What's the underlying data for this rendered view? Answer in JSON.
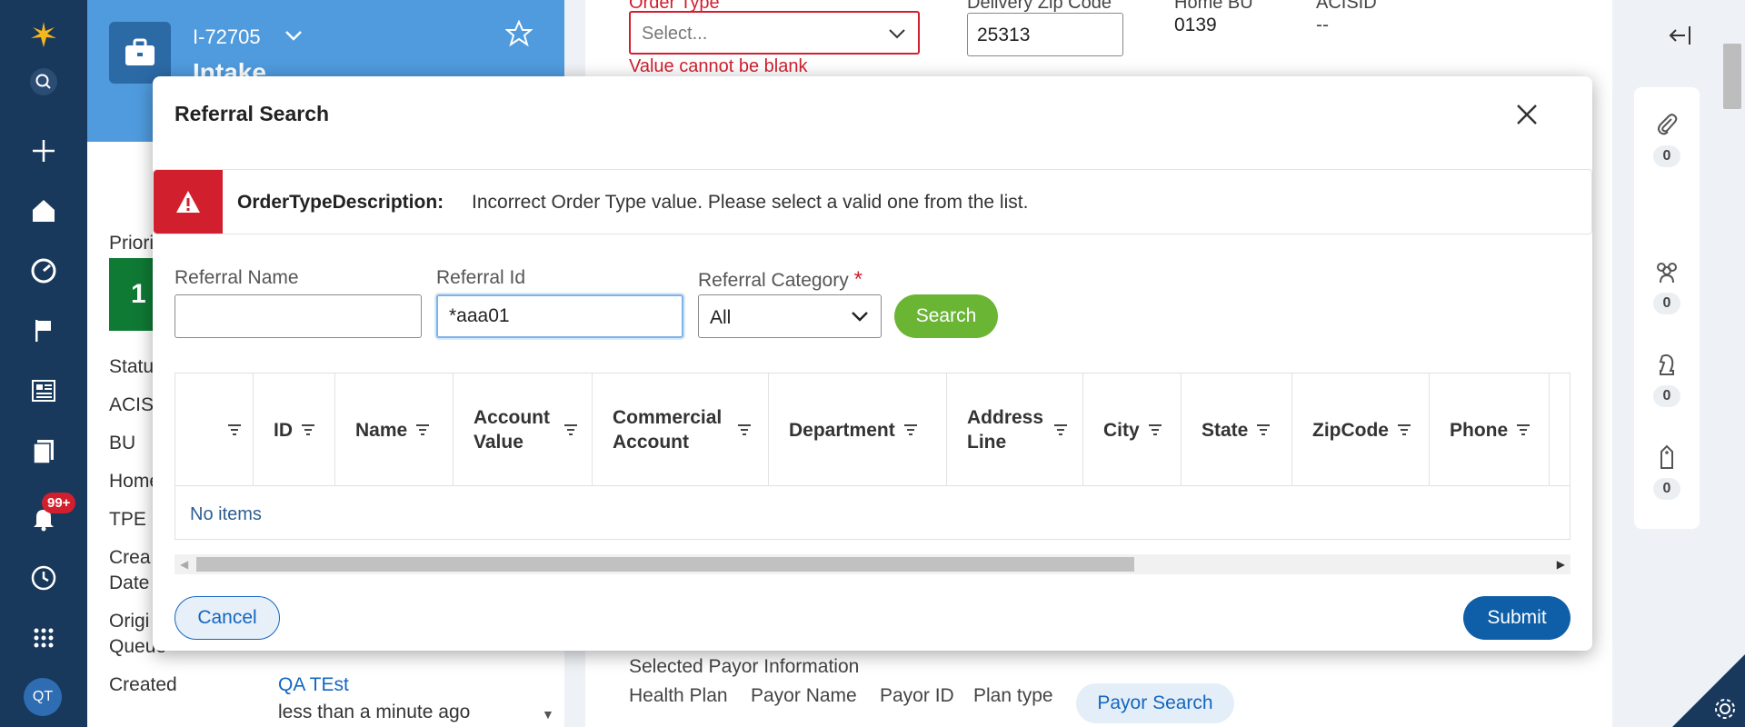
{
  "case": {
    "id": "I-72705",
    "title": "Intake",
    "priority_value": "1",
    "field_labels": [
      "Priority",
      "Status",
      "ACIS",
      "BU",
      "Home",
      "TPE",
      "Crea",
      "Date",
      "Origi",
      "Queue",
      "Created"
    ],
    "created_by": "QA TEst",
    "created_when": "less than a minute ago"
  },
  "nav": {
    "badge": "99+",
    "avatar": "QT"
  },
  "form": {
    "order_type_label": "Order Type",
    "order_type_placeholder": "Select...",
    "order_type_error": "Value cannot be blank",
    "delivery_zip_label": "Delivery Zip Code",
    "delivery_zip_value": "25313",
    "home_bu_label": "Home BU",
    "home_bu_value": "0139",
    "acisid_label": "ACISID",
    "acisid_value": "--",
    "payor_section_title": "Selected Payor Information",
    "payor_columns": [
      "Health Plan",
      "Payor Name",
      "Payor ID",
      "Plan type"
    ],
    "payor_search_label": "Payor Search"
  },
  "rail": {
    "counts": [
      "0",
      "0",
      "0",
      "0"
    ]
  },
  "modal": {
    "title": "Referral Search",
    "alert_key": "OrderTypeDescription:",
    "alert_message": "Incorrect Order Type value. Please select a valid one from the list.",
    "referral_name_label": "Referral Name",
    "referral_name_value": "",
    "referral_id_label": "Referral Id",
    "referral_id_value": "*aaa01",
    "referral_category_label": "Referral Category",
    "referral_category_value": "All",
    "search_label": "Search",
    "columns": [
      "",
      "ID",
      "Name",
      "Account Value",
      "Commercial Account",
      "Department",
      "Address Line",
      "City",
      "State",
      "ZipCode",
      "Phone"
    ],
    "empty_text": "No items",
    "cancel_label": "Cancel",
    "submit_label": "Submit"
  },
  "colors": {
    "nav_bg": "#18385c",
    "case_header": "#4f9bde",
    "error_red": "#d11f2e",
    "search_green": "#6bb535",
    "submit_blue": "#0e5ea8"
  }
}
